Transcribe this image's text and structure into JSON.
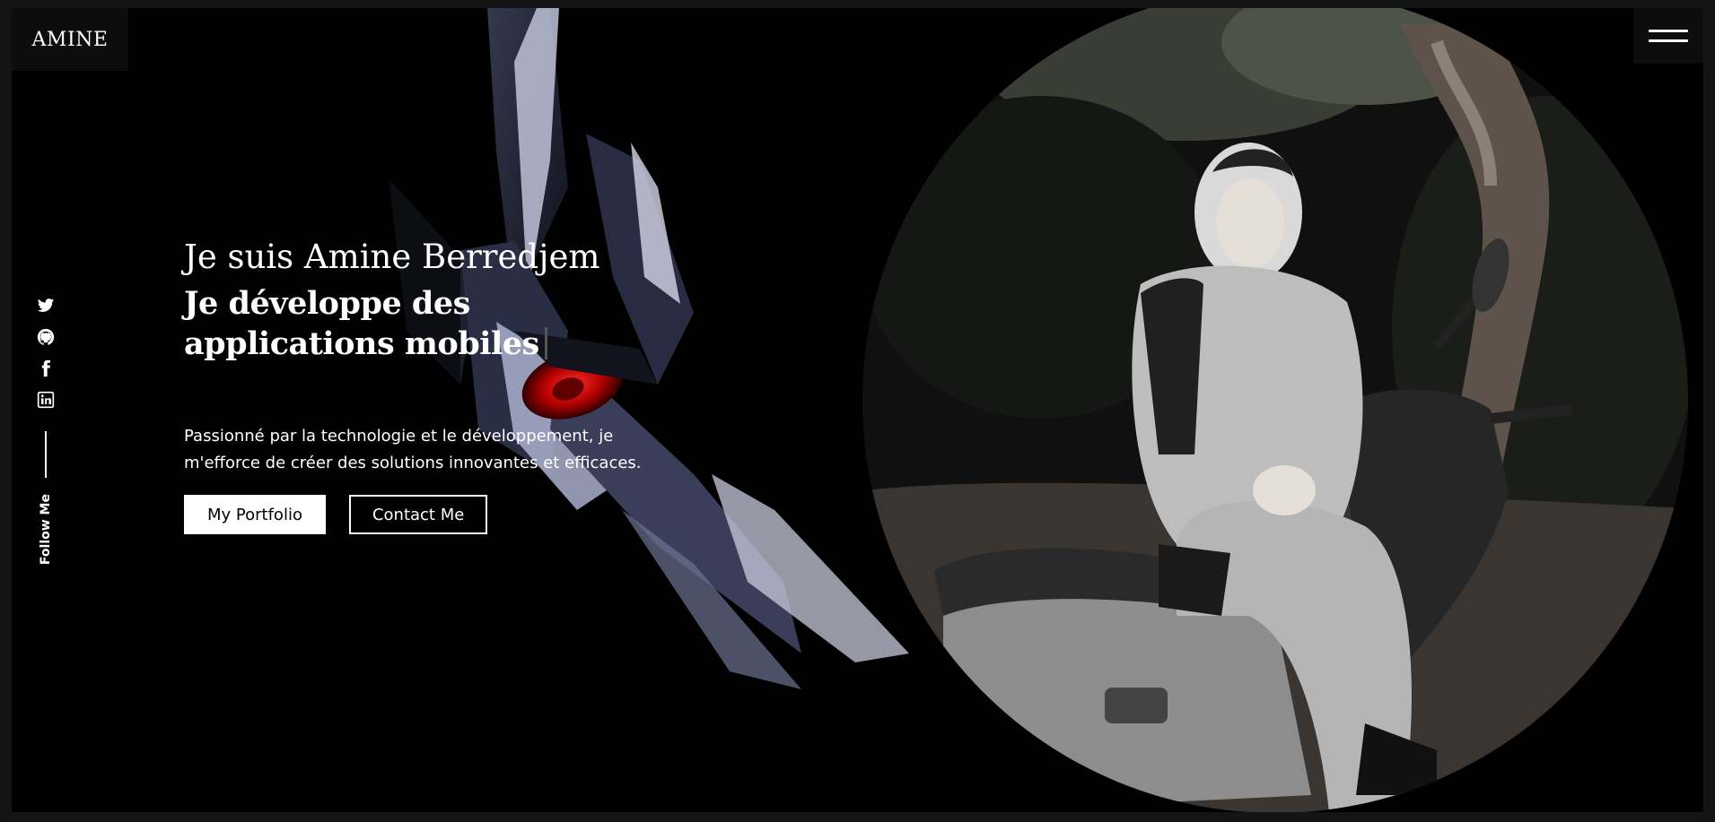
{
  "logo": {
    "text": "AMINE"
  },
  "menu": {
    "icon": "hamburger-menu-icon"
  },
  "social": {
    "icons": [
      "twitter-icon",
      "github-icon",
      "facebook-icon",
      "linkedin-icon"
    ],
    "follow_label": "Follow Me"
  },
  "hero": {
    "greeting": "Je suis Amine Berredjem",
    "headline": "Je développe des applications mobiles",
    "description": "Passionné par la technologie et le développement, je m'efforce de créer des solutions innovantes et efficaces.",
    "buttons": {
      "portfolio": "My Portfolio",
      "contact": "Contact Me"
    }
  },
  "colors": {
    "background": "#000000",
    "text": "#ffffff",
    "primary_button_bg": "#ffffff",
    "primary_button_text": "#000000"
  }
}
